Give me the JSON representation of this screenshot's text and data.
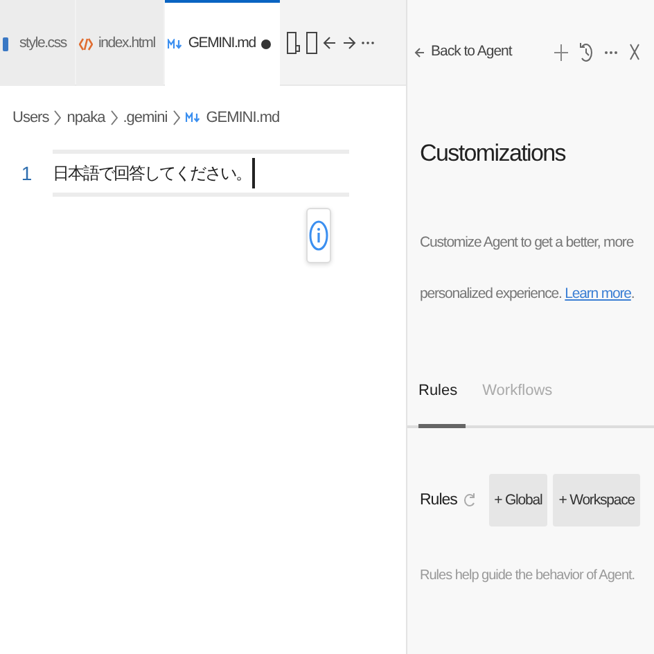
{
  "tabs": [
    {
      "label": "style.css",
      "kind": "css",
      "selected": false,
      "modified": false
    },
    {
      "label": "index.html",
      "kind": "html",
      "selected": false,
      "modified": false
    },
    {
      "label": "GEMINI.md",
      "kind": "md",
      "selected": true,
      "modified": true
    }
  ],
  "breadcrumb": [
    {
      "label": "Users",
      "kind": "folder"
    },
    {
      "label": "npaka",
      "kind": "folder"
    },
    {
      "label": ".gemini",
      "kind": "folder"
    },
    {
      "label": "GEMINI.md",
      "kind": "md"
    }
  ],
  "editor": {
    "lines": [
      {
        "number": "1",
        "text": "日本語で回答してください。",
        "current": true
      }
    ]
  },
  "panel": {
    "back": "Back to Agent",
    "title": "Customizations",
    "description": "Customize Agent to get a better, more personalized experience.",
    "link": "Learn more",
    "after_link": ".",
    "tabs": [
      {
        "label": "Rules",
        "selected": true
      },
      {
        "label": "Workflows",
        "selected": false
      }
    ],
    "section": {
      "title": "Rules",
      "buttons": [
        "+ Global",
        "+ Workspace"
      ],
      "hint": "Rules help guide the behavior of Agent."
    }
  }
}
